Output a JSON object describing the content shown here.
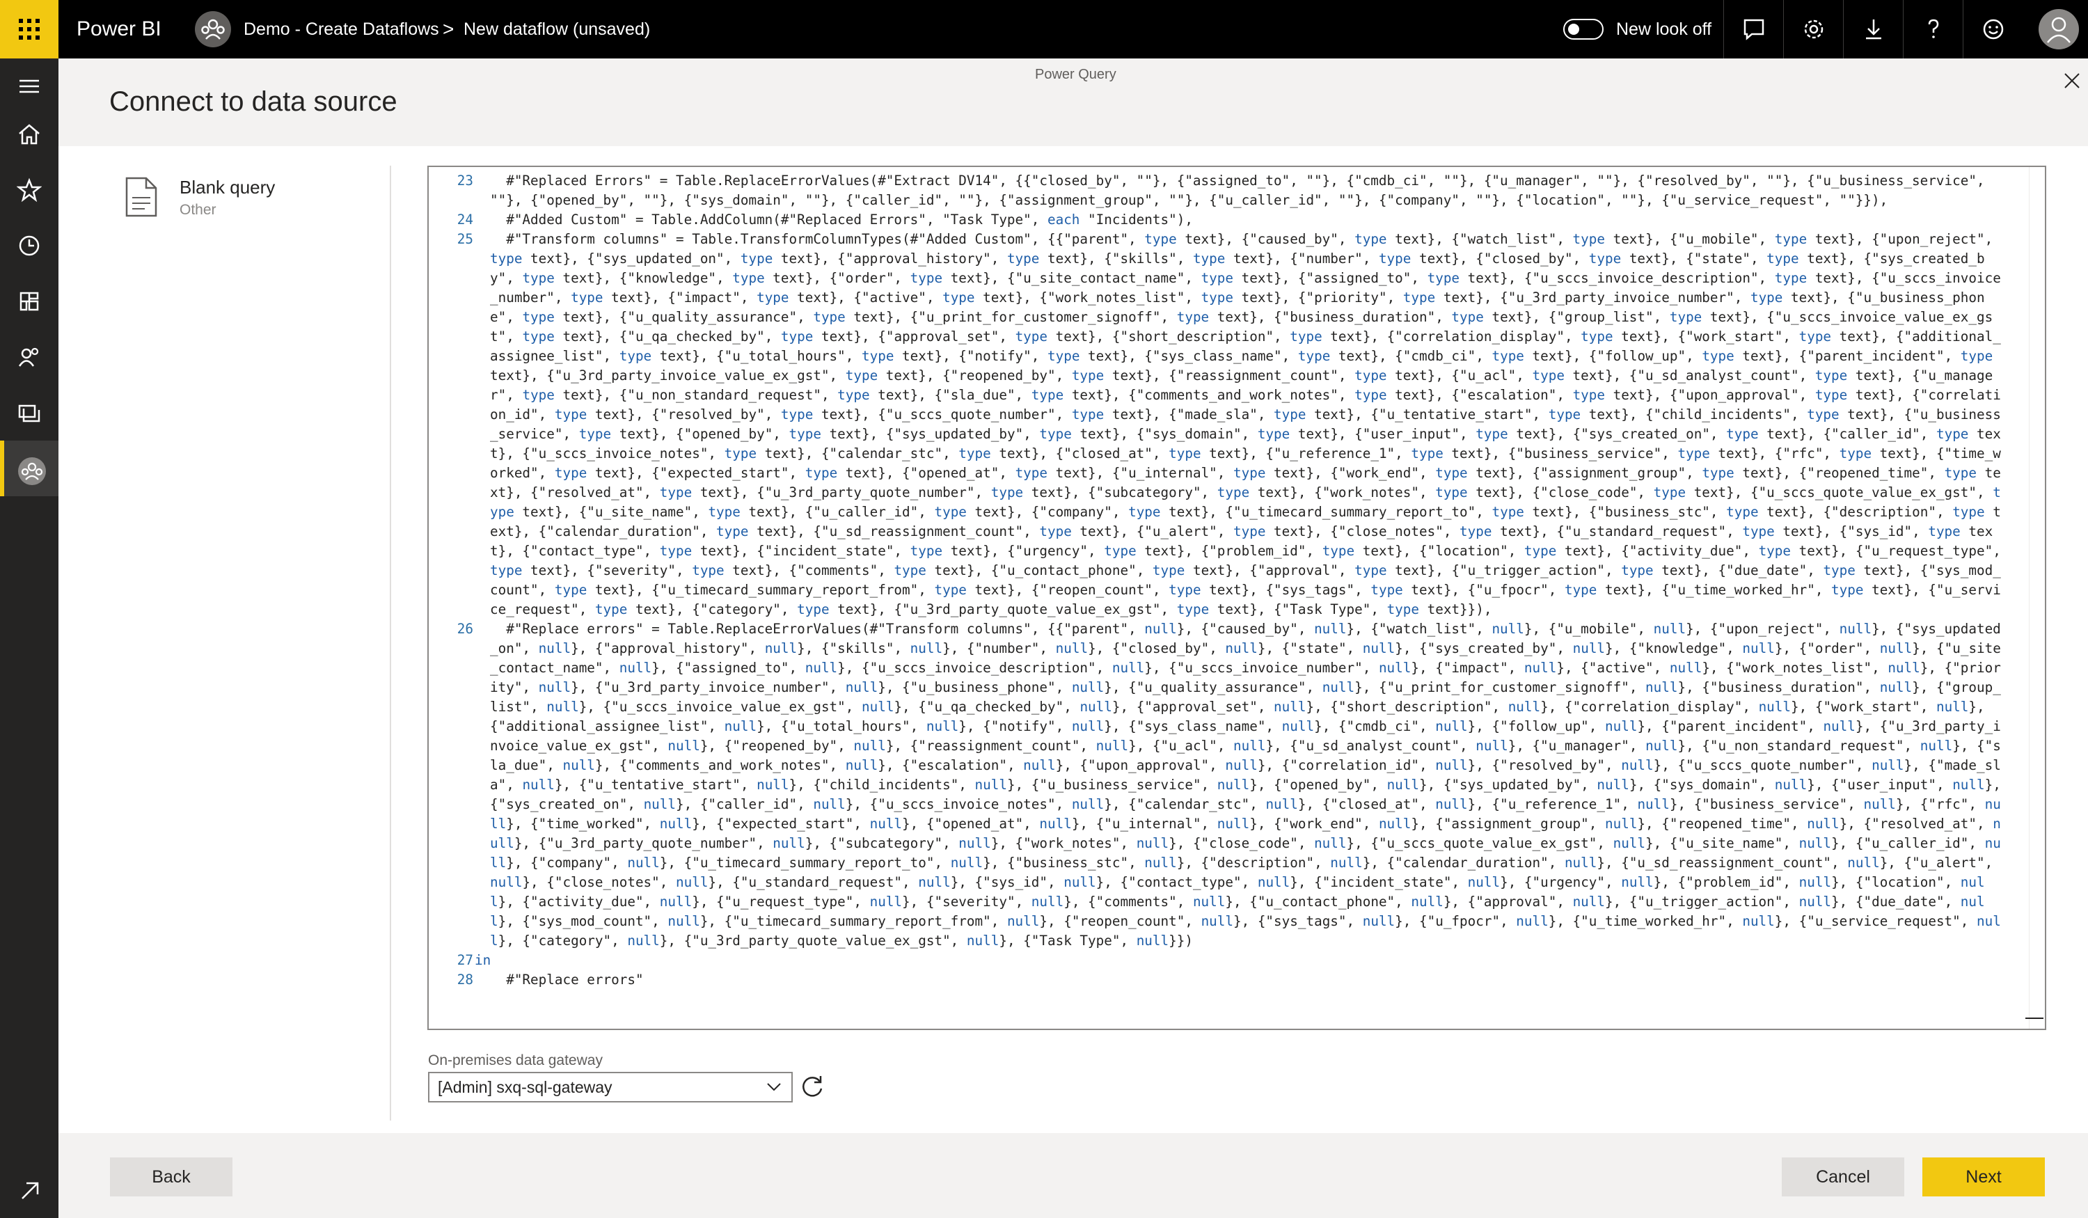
{
  "app": {
    "brand": "Power BI"
  },
  "breadcrumb": {
    "workspace": "Demo - Create Dataflows",
    "separator": ">",
    "dataflow": "New dataflow (unsaved)"
  },
  "header": {
    "toggle_label": "New look off",
    "toggle_on": false,
    "icons": [
      "chat-icon",
      "gear-icon",
      "download-icon",
      "help-icon",
      "smiley-icon",
      "user-icon"
    ]
  },
  "leftnav": {
    "items": [
      "hamburger-icon",
      "home-icon",
      "star-icon",
      "clock-icon",
      "apps-icon",
      "people-icon",
      "workspaces-icon",
      "workspace-active-icon"
    ],
    "bottom": "expand-arrow-icon"
  },
  "dialog": {
    "window_title": "Power Query",
    "title": "Connect to data source",
    "source": {
      "name": "Blank query",
      "category": "Other"
    },
    "code_lines": [
      {
        "num": "23",
        "text": "  #\"Replaced Errors\" = Table.ReplaceErrorValues(#\"Extract DV14\", {{\"closed_by\", \"\"}, {\"assigned_to\", \"\"}, {\"cmdb_ci\", \"\"}, {\"u_manager\", \"\"}, {\"resolved_by\", \"\"}, {\"u_business_service\", \"\"}, {\"opened_by\", \"\"}, {\"sys_domain\", \"\"}, {\"caller_id\", \"\"}, {\"assignment_group\", \"\"}, {\"u_caller_id\", \"\"}, {\"company\", \"\"}, {\"location\", \"\"}, {\"u_service_request\", \"\"}}),"
      },
      {
        "num": "24",
        "text": "  #\"Added Custom\" = Table.AddColumn(#\"Replaced Errors\", \"Task Type\", each \"Incidents\"),"
      },
      {
        "num": "25",
        "text": "  #\"Transform columns\" = Table.TransformColumnTypes(#\"Added Custom\", {{\"parent\", type text}, {\"caused_by\", type text}, {\"watch_list\", type text}, {\"u_mobile\", type text}, {\"upon_reject\", type text}, {\"sys_updated_on\", type text}, {\"approval_history\", type text}, {\"skills\", type text}, {\"number\", type text}, {\"closed_by\", type text}, {\"state\", type text}, {\"sys_created_by\", type text}, {\"knowledge\", type text}, {\"order\", type text}, {\"u_site_contact_name\", type text}, {\"assigned_to\", type text}, {\"u_sccs_invoice_description\", type text}, {\"u_sccs_invoice_number\", type text}, {\"impact\", type text}, {\"active\", type text}, {\"work_notes_list\", type text}, {\"priority\", type text}, {\"u_3rd_party_invoice_number\", type text}, {\"u_business_phone\", type text}, {\"u_quality_assurance\", type text}, {\"u_print_for_customer_signoff\", type text}, {\"business_duration\", type text}, {\"group_list\", type text}, {\"u_sccs_invoice_value_ex_gst\", type text}, {\"u_qa_checked_by\", type text}, {\"approval_set\", type text}, {\"short_description\", type text}, {\"correlation_display\", type text}, {\"work_start\", type text}, {\"additional_assignee_list\", type text}, {\"u_total_hours\", type text}, {\"notify\", type text}, {\"sys_class_name\", type text}, {\"cmdb_ci\", type text}, {\"follow_up\", type text}, {\"parent_incident\", type text}, {\"u_3rd_party_invoice_value_ex_gst\", type text}, {\"reopened_by\", type text}, {\"reassignment_count\", type text}, {\"u_acl\", type text}, {\"u_sd_analyst_count\", type text}, {\"u_manager\", type text}, {\"u_non_standard_request\", type text}, {\"sla_due\", type text}, {\"comments_and_work_notes\", type text}, {\"escalation\", type text}, {\"upon_approval\", type text}, {\"correlation_id\", type text}, {\"resolved_by\", type text}, {\"u_sccs_quote_number\", type text}, {\"made_sla\", type text}, {\"u_tentative_start\", type text}, {\"child_incidents\", type text}, {\"u_business_service\", type text}, {\"opened_by\", type text}, {\"sys_updated_by\", type text}, {\"sys_domain\", type text}, {\"user_input\", type text}, {\"sys_created_on\", type text}, {\"caller_id\", type text}, {\"u_sccs_invoice_notes\", type text}, {\"calendar_stc\", type text}, {\"closed_at\", type text}, {\"u_reference_1\", type text}, {\"business_service\", type text}, {\"rfc\", type text}, {\"time_worked\", type text}, {\"expected_start\", type text}, {\"opened_at\", type text}, {\"u_internal\", type text}, {\"work_end\", type text}, {\"assignment_group\", type text}, {\"reopened_time\", type text}, {\"resolved_at\", type text}, {\"u_3rd_party_quote_number\", type text}, {\"subcategory\", type text}, {\"work_notes\", type text}, {\"close_code\", type text}, {\"u_sccs_quote_value_ex_gst\", type text}, {\"u_site_name\", type text}, {\"u_caller_id\", type text}, {\"company\", type text}, {\"u_timecard_summary_report_to\", type text}, {\"business_stc\", type text}, {\"description\", type text}, {\"calendar_duration\", type text}, {\"u_sd_reassignment_count\", type text}, {\"u_alert\", type text}, {\"close_notes\", type text}, {\"u_standard_request\", type text}, {\"sys_id\", type text}, {\"contact_type\", type text}, {\"incident_state\", type text}, {\"urgency\", type text}, {\"problem_id\", type text}, {\"location\", type text}, {\"activity_due\", type text}, {\"u_request_type\", type text}, {\"severity\", type text}, {\"comments\", type text}, {\"u_contact_phone\", type text}, {\"approval\", type text}, {\"u_trigger_action\", type text}, {\"due_date\", type text}, {\"sys_mod_count\", type text}, {\"u_timecard_summary_report_from\", type text}, {\"reopen_count\", type text}, {\"sys_tags\", type text}, {\"u_fpocr\", type text}, {\"u_time_worked_hr\", type text}, {\"u_service_request\", type text}, {\"category\", type text}, {\"u_3rd_party_quote_value_ex_gst\", type text}, {\"Task Type\", type text}}),"
      },
      {
        "num": "26",
        "text": "  #\"Replace errors\" = Table.ReplaceErrorValues(#\"Transform columns\", {{\"parent\", null}, {\"caused_by\", null}, {\"watch_list\", null}, {\"u_mobile\", null}, {\"upon_reject\", null}, {\"sys_updated_on\", null}, {\"approval_history\", null}, {\"skills\", null}, {\"number\", null}, {\"closed_by\", null}, {\"state\", null}, {\"sys_created_by\", null}, {\"knowledge\", null}, {\"order\", null}, {\"u_site_contact_name\", null}, {\"assigned_to\", null}, {\"u_sccs_invoice_description\", null}, {\"u_sccs_invoice_number\", null}, {\"impact\", null}, {\"active\", null}, {\"work_notes_list\", null}, {\"priority\", null}, {\"u_3rd_party_invoice_number\", null}, {\"u_business_phone\", null}, {\"u_quality_assurance\", null}, {\"u_print_for_customer_signoff\", null}, {\"business_duration\", null}, {\"group_list\", null}, {\"u_sccs_invoice_value_ex_gst\", null}, {\"u_qa_checked_by\", null}, {\"approval_set\", null}, {\"short_description\", null}, {\"correlation_display\", null}, {\"work_start\", null}, {\"additional_assignee_list\", null}, {\"u_total_hours\", null}, {\"notify\", null}, {\"sys_class_name\", null}, {\"cmdb_ci\", null}, {\"follow_up\", null}, {\"parent_incident\", null}, {\"u_3rd_party_invoice_value_ex_gst\", null}, {\"reopened_by\", null}, {\"reassignment_count\", null}, {\"u_acl\", null}, {\"u_sd_analyst_count\", null}, {\"u_manager\", null}, {\"u_non_standard_request\", null}, {\"sla_due\", null}, {\"comments_and_work_notes\", null}, {\"escalation\", null}, {\"upon_approval\", null}, {\"correlation_id\", null}, {\"resolved_by\", null}, {\"u_sccs_quote_number\", null}, {\"made_sla\", null}, {\"u_tentative_start\", null}, {\"child_incidents\", null}, {\"u_business_service\", null}, {\"opened_by\", null}, {\"sys_updated_by\", null}, {\"sys_domain\", null}, {\"user_input\", null}, {\"sys_created_on\", null}, {\"caller_id\", null}, {\"u_sccs_invoice_notes\", null}, {\"calendar_stc\", null}, {\"closed_at\", null}, {\"u_reference_1\", null}, {\"business_service\", null}, {\"rfc\", null}, {\"time_worked\", null}, {\"expected_start\", null}, {\"opened_at\", null}, {\"u_internal\", null}, {\"work_end\", null}, {\"assignment_group\", null}, {\"reopened_time\", null}, {\"resolved_at\", null}, {\"u_3rd_party_quote_number\", null}, {\"subcategory\", null}, {\"work_notes\", null}, {\"close_code\", null}, {\"u_sccs_quote_value_ex_gst\", null}, {\"u_site_name\", null}, {\"u_caller_id\", null}, {\"company\", null}, {\"u_timecard_summary_report_to\", null}, {\"business_stc\", null}, {\"description\", null}, {\"calendar_duration\", null}, {\"u_sd_reassignment_count\", null}, {\"u_alert\", null}, {\"close_notes\", null}, {\"u_standard_request\", null}, {\"sys_id\", null}, {\"contact_type\", null}, {\"incident_state\", null}, {\"urgency\", null}, {\"problem_id\", null}, {\"location\", null}, {\"activity_due\", null}, {\"u_request_type\", null}, {\"severity\", null}, {\"comments\", null}, {\"u_contact_phone\", null}, {\"approval\", null}, {\"u_trigger_action\", null}, {\"due_date\", null}, {\"sys_mod_count\", null}, {\"u_timecard_summary_report_from\", null}, {\"reopen_count\", null}, {\"sys_tags\", null}, {\"u_fpocr\", null}, {\"u_time_worked_hr\", null}, {\"u_service_request\", null}, {\"category\", null}, {\"u_3rd_party_quote_value_ex_gst\", null}, {\"Task Type\", null}})"
      },
      {
        "num": "27",
        "text": "in"
      },
      {
        "num": "28",
        "text": "  #\"Replace errors\""
      }
    ],
    "gateway": {
      "label": "On-premises data gateway",
      "value": "[Admin] sxq-sql-gateway"
    },
    "buttons": {
      "back": "Back",
      "cancel": "Cancel",
      "next": "Next"
    }
  },
  "colors": {
    "accent": "#f2c811",
    "topbar": "#000000",
    "leftnav": "#252423",
    "line_number": "#2b6ea6",
    "keyword": "#1f5ea8"
  }
}
